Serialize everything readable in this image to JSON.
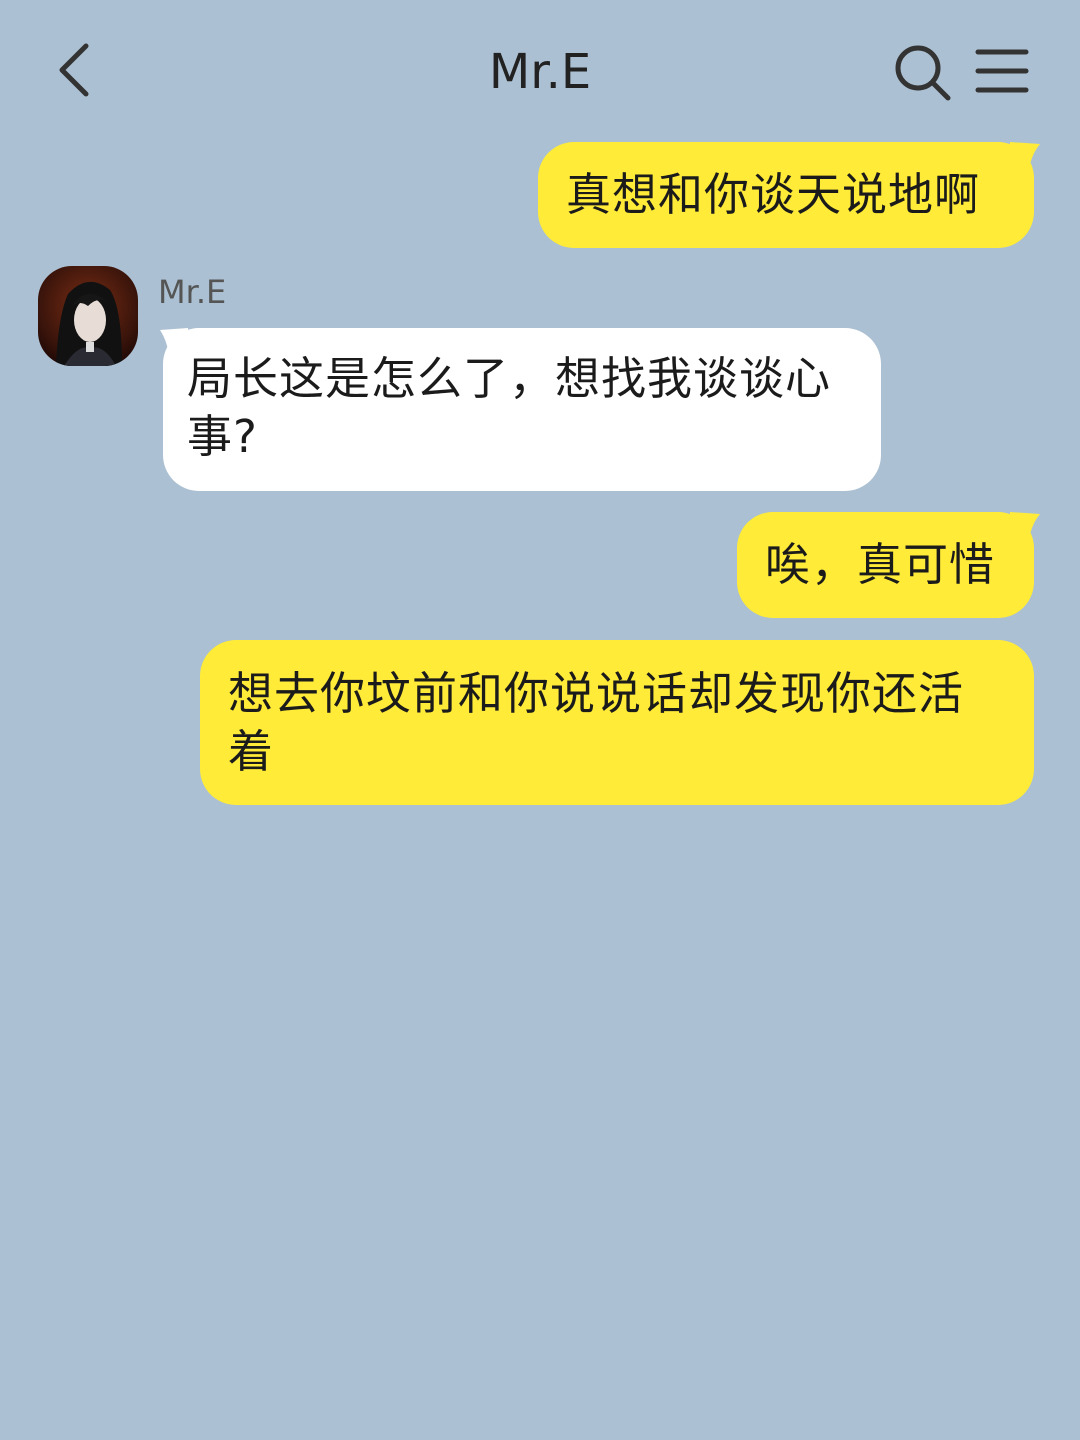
{
  "header": {
    "title": "Mr.E",
    "back_icon": "chevron-left-icon",
    "search_icon": "search-icon",
    "menu_icon": "menu-icon"
  },
  "contact": {
    "name": "Mr.E"
  },
  "colors": {
    "background": "#abc0d2",
    "my_bubble": "#ffeb38",
    "their_bubble": "#ffffff"
  },
  "messages": [
    {
      "sender": "me",
      "text": "真想和你谈天说地啊"
    },
    {
      "sender": "Mr.E",
      "text": "局长这是怎么了，想找我谈谈心事?"
    },
    {
      "sender": "me",
      "text": "唉，真可惜"
    },
    {
      "sender": "me",
      "text": "想去你坟前和你说说话却发现你还活着"
    }
  ]
}
